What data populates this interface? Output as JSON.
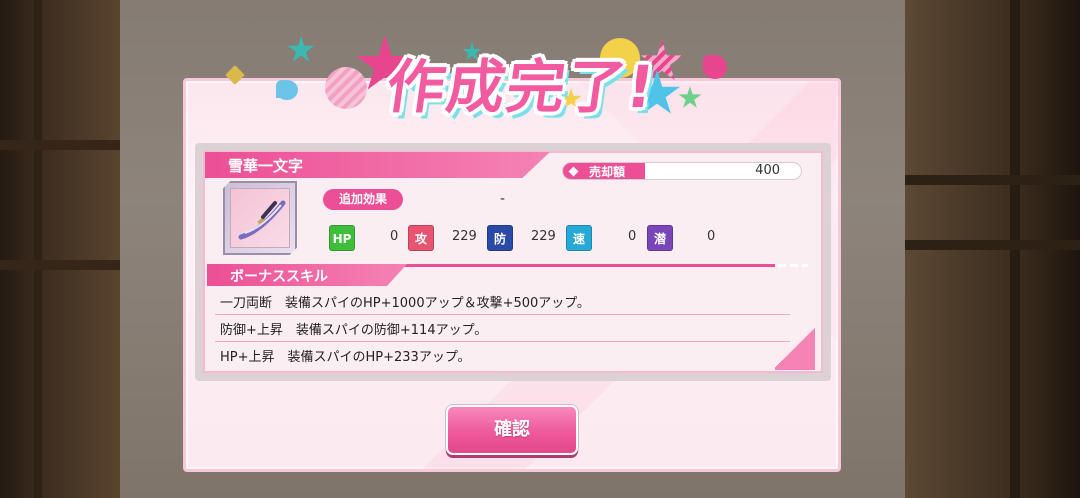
{
  "title": "作成完了!",
  "item": {
    "name": "雪華一文字",
    "sale_label": "売却額",
    "sale_value": "400",
    "effect_label": "追加効果",
    "effect_value": "-"
  },
  "stats": [
    {
      "icon": "HP",
      "color": "#3fbe3b",
      "value": "0"
    },
    {
      "icon": "攻",
      "color": "#e8546f",
      "value": "229"
    },
    {
      "icon": "防",
      "color": "#2b4aa8",
      "value": "229"
    },
    {
      "icon": "速",
      "color": "#26a9d6",
      "value": "0"
    },
    {
      "icon": "潜",
      "color": "#7a45b8",
      "value": "0"
    }
  ],
  "bonus": {
    "title": "ボーナススキル",
    "skills": [
      "一刀両断　装備スパイのHP+1000アップ＆攻撃+500アップ。",
      "防御+上昇　装備スパイの防御+114アップ。",
      "HP+上昇　装備スパイのHP+233アップ。"
    ]
  },
  "confirm_label": "確認",
  "colors": {
    "accent": "#ec4f95",
    "panel": "#fbeef3"
  }
}
